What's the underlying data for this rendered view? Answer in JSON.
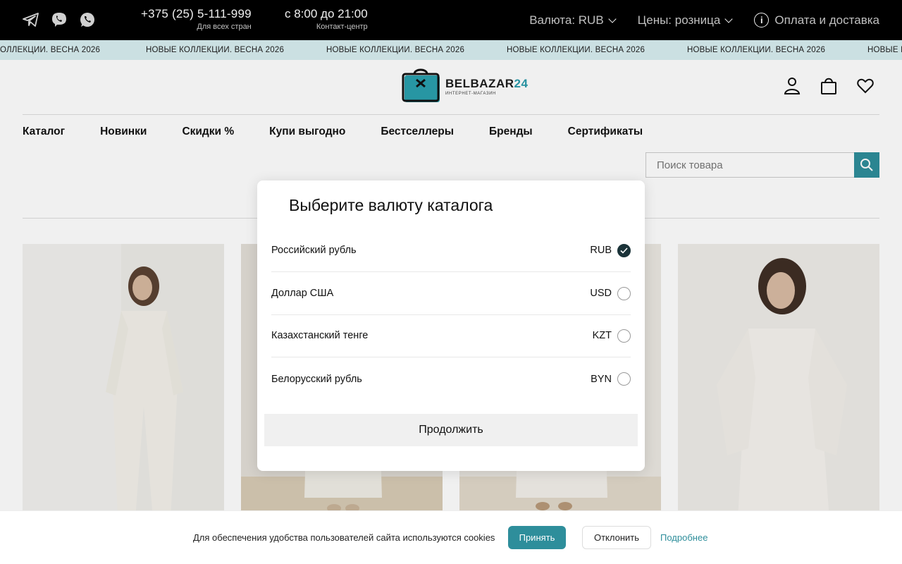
{
  "topbar": {
    "phone": "+375 (25) 5-111-999",
    "phone_note": "Для всех стран",
    "hours": "с 8:00 до 21:00",
    "hours_note": "Контакт-центр",
    "currency_label": "Валюта: RUB",
    "prices_label": "Цены: розница",
    "delivery_label": "Оплата и доставка"
  },
  "ticker": {
    "items": [
      "ОЛЛЕКЦИИ. ВЕСНА 2026",
      "НОВЫЕ КОЛЛЕКЦИИ. ВЕСНА 2026",
      "НОВЫЕ КОЛЛЕКЦИИ. ВЕСНА 2026",
      "НОВЫЕ КОЛЛЕКЦИИ. ВЕСНА 2026",
      "НОВЫЕ КОЛЛЕКЦИИ. ВЕСНА 2026",
      "НОВЫЕ К"
    ]
  },
  "logo": {
    "name_main": "BELBAZAR",
    "name_accent": "24",
    "tagline": "ИНТЕРНЕТ-МАГАЗИН"
  },
  "nav": {
    "items": [
      "Каталог",
      "Новинки",
      "Скидки %",
      "Купи выгодно",
      "Бестселлеры",
      "Бренды",
      "Сертификаты"
    ]
  },
  "search": {
    "placeholder": "Поиск товара"
  },
  "modal": {
    "title": "Выберите валюту каталога",
    "options": [
      {
        "name": "Российский рубль",
        "code": "RUB",
        "selected": true
      },
      {
        "name": "Доллар США",
        "code": "USD",
        "selected": false
      },
      {
        "name": "Казахстанский тенге",
        "code": "KZT",
        "selected": false
      },
      {
        "name": "Белорусский рубль",
        "code": "BYN",
        "selected": false
      }
    ],
    "continue_label": "Продолжить"
  },
  "cookie": {
    "message": "Для обеспечения удобства пользователей сайта используются cookies",
    "accept_label": "Принять",
    "decline_label": "Отклонить",
    "more_label": "Подробнее"
  },
  "colors": {
    "accent": "#2e8e9b",
    "topbar_bg": "#000000",
    "ticker_bg": "#d8eef1",
    "selected_radio": "#1b3339"
  },
  "icons": [
    "telegram-icon",
    "viber-icon",
    "whatsapp-icon",
    "chevron-down-icon",
    "info-icon",
    "user-icon",
    "bag-icon",
    "heart-icon",
    "search-icon",
    "check-icon"
  ]
}
